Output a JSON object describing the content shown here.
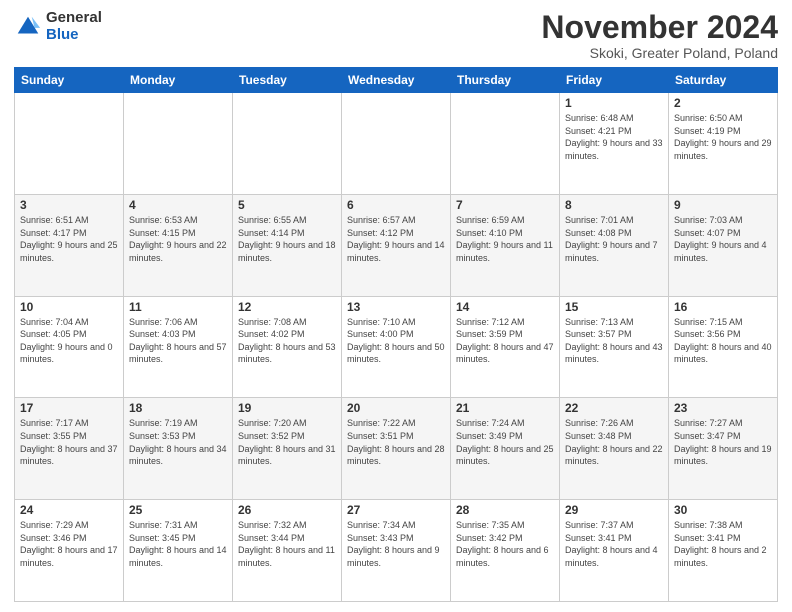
{
  "logo": {
    "general": "General",
    "blue": "Blue"
  },
  "title": "November 2024",
  "location": "Skoki, Greater Poland, Poland",
  "headers": [
    "Sunday",
    "Monday",
    "Tuesday",
    "Wednesday",
    "Thursday",
    "Friday",
    "Saturday"
  ],
  "weeks": [
    [
      {
        "day": "",
        "sunrise": "",
        "sunset": "",
        "daylight": ""
      },
      {
        "day": "",
        "sunrise": "",
        "sunset": "",
        "daylight": ""
      },
      {
        "day": "",
        "sunrise": "",
        "sunset": "",
        "daylight": ""
      },
      {
        "day": "",
        "sunrise": "",
        "sunset": "",
        "daylight": ""
      },
      {
        "day": "",
        "sunrise": "",
        "sunset": "",
        "daylight": ""
      },
      {
        "day": "1",
        "sunrise": "Sunrise: 6:48 AM",
        "sunset": "Sunset: 4:21 PM",
        "daylight": "Daylight: 9 hours and 33 minutes."
      },
      {
        "day": "2",
        "sunrise": "Sunrise: 6:50 AM",
        "sunset": "Sunset: 4:19 PM",
        "daylight": "Daylight: 9 hours and 29 minutes."
      }
    ],
    [
      {
        "day": "3",
        "sunrise": "Sunrise: 6:51 AM",
        "sunset": "Sunset: 4:17 PM",
        "daylight": "Daylight: 9 hours and 25 minutes."
      },
      {
        "day": "4",
        "sunrise": "Sunrise: 6:53 AM",
        "sunset": "Sunset: 4:15 PM",
        "daylight": "Daylight: 9 hours and 22 minutes."
      },
      {
        "day": "5",
        "sunrise": "Sunrise: 6:55 AM",
        "sunset": "Sunset: 4:14 PM",
        "daylight": "Daylight: 9 hours and 18 minutes."
      },
      {
        "day": "6",
        "sunrise": "Sunrise: 6:57 AM",
        "sunset": "Sunset: 4:12 PM",
        "daylight": "Daylight: 9 hours and 14 minutes."
      },
      {
        "day": "7",
        "sunrise": "Sunrise: 6:59 AM",
        "sunset": "Sunset: 4:10 PM",
        "daylight": "Daylight: 9 hours and 11 minutes."
      },
      {
        "day": "8",
        "sunrise": "Sunrise: 7:01 AM",
        "sunset": "Sunset: 4:08 PM",
        "daylight": "Daylight: 9 hours and 7 minutes."
      },
      {
        "day": "9",
        "sunrise": "Sunrise: 7:03 AM",
        "sunset": "Sunset: 4:07 PM",
        "daylight": "Daylight: 9 hours and 4 minutes."
      }
    ],
    [
      {
        "day": "10",
        "sunrise": "Sunrise: 7:04 AM",
        "sunset": "Sunset: 4:05 PM",
        "daylight": "Daylight: 9 hours and 0 minutes."
      },
      {
        "day": "11",
        "sunrise": "Sunrise: 7:06 AM",
        "sunset": "Sunset: 4:03 PM",
        "daylight": "Daylight: 8 hours and 57 minutes."
      },
      {
        "day": "12",
        "sunrise": "Sunrise: 7:08 AM",
        "sunset": "Sunset: 4:02 PM",
        "daylight": "Daylight: 8 hours and 53 minutes."
      },
      {
        "day": "13",
        "sunrise": "Sunrise: 7:10 AM",
        "sunset": "Sunset: 4:00 PM",
        "daylight": "Daylight: 8 hours and 50 minutes."
      },
      {
        "day": "14",
        "sunrise": "Sunrise: 7:12 AM",
        "sunset": "Sunset: 3:59 PM",
        "daylight": "Daylight: 8 hours and 47 minutes."
      },
      {
        "day": "15",
        "sunrise": "Sunrise: 7:13 AM",
        "sunset": "Sunset: 3:57 PM",
        "daylight": "Daylight: 8 hours and 43 minutes."
      },
      {
        "day": "16",
        "sunrise": "Sunrise: 7:15 AM",
        "sunset": "Sunset: 3:56 PM",
        "daylight": "Daylight: 8 hours and 40 minutes."
      }
    ],
    [
      {
        "day": "17",
        "sunrise": "Sunrise: 7:17 AM",
        "sunset": "Sunset: 3:55 PM",
        "daylight": "Daylight: 8 hours and 37 minutes."
      },
      {
        "day": "18",
        "sunrise": "Sunrise: 7:19 AM",
        "sunset": "Sunset: 3:53 PM",
        "daylight": "Daylight: 8 hours and 34 minutes."
      },
      {
        "day": "19",
        "sunrise": "Sunrise: 7:20 AM",
        "sunset": "Sunset: 3:52 PM",
        "daylight": "Daylight: 8 hours and 31 minutes."
      },
      {
        "day": "20",
        "sunrise": "Sunrise: 7:22 AM",
        "sunset": "Sunset: 3:51 PM",
        "daylight": "Daylight: 8 hours and 28 minutes."
      },
      {
        "day": "21",
        "sunrise": "Sunrise: 7:24 AM",
        "sunset": "Sunset: 3:49 PM",
        "daylight": "Daylight: 8 hours and 25 minutes."
      },
      {
        "day": "22",
        "sunrise": "Sunrise: 7:26 AM",
        "sunset": "Sunset: 3:48 PM",
        "daylight": "Daylight: 8 hours and 22 minutes."
      },
      {
        "day": "23",
        "sunrise": "Sunrise: 7:27 AM",
        "sunset": "Sunset: 3:47 PM",
        "daylight": "Daylight: 8 hours and 19 minutes."
      }
    ],
    [
      {
        "day": "24",
        "sunrise": "Sunrise: 7:29 AM",
        "sunset": "Sunset: 3:46 PM",
        "daylight": "Daylight: 8 hours and 17 minutes."
      },
      {
        "day": "25",
        "sunrise": "Sunrise: 7:31 AM",
        "sunset": "Sunset: 3:45 PM",
        "daylight": "Daylight: 8 hours and 14 minutes."
      },
      {
        "day": "26",
        "sunrise": "Sunrise: 7:32 AM",
        "sunset": "Sunset: 3:44 PM",
        "daylight": "Daylight: 8 hours and 11 minutes."
      },
      {
        "day": "27",
        "sunrise": "Sunrise: 7:34 AM",
        "sunset": "Sunset: 3:43 PM",
        "daylight": "Daylight: 8 hours and 9 minutes."
      },
      {
        "day": "28",
        "sunrise": "Sunrise: 7:35 AM",
        "sunset": "Sunset: 3:42 PM",
        "daylight": "Daylight: 8 hours and 6 minutes."
      },
      {
        "day": "29",
        "sunrise": "Sunrise: 7:37 AM",
        "sunset": "Sunset: 3:41 PM",
        "daylight": "Daylight: 8 hours and 4 minutes."
      },
      {
        "day": "30",
        "sunrise": "Sunrise: 7:38 AM",
        "sunset": "Sunset: 3:41 PM",
        "daylight": "Daylight: 8 hours and 2 minutes."
      }
    ]
  ]
}
